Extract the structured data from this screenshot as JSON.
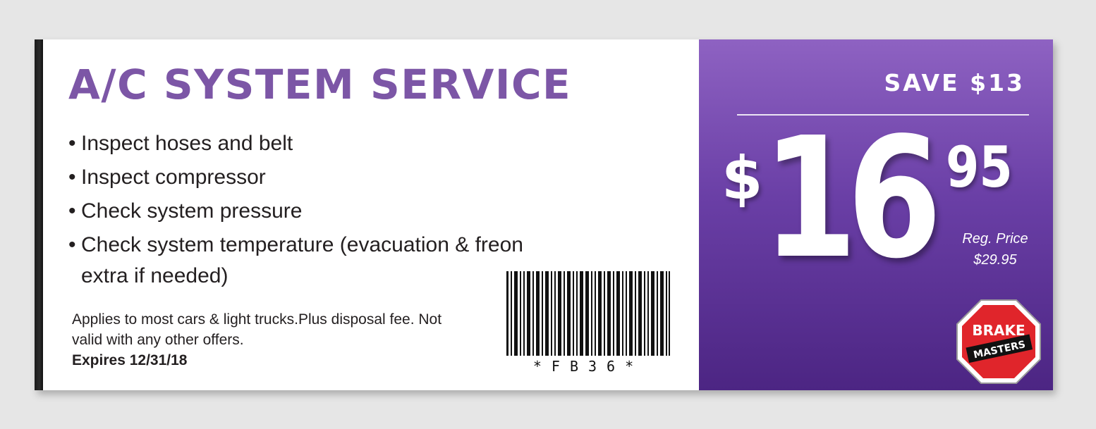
{
  "coupon": {
    "title": "A/C SYSTEM SERVICE",
    "bullets": [
      "Inspect hoses and belt",
      "Inspect compressor",
      "Check system pressure",
      "Check system temperature (evacuation & freon"
    ],
    "bullet_continuation": "extra if needed)",
    "bullet_marker": "•",
    "fine_print": "Applies to most cars & light trucks.Plus disposal fee. Not valid with any other offers.",
    "expires": "Expires 12/31/18",
    "barcode_text": "*FB36*"
  },
  "offer": {
    "save_label": "SAVE $13",
    "dollar_sign": "$",
    "price_dollars": "16",
    "price_cents": "95",
    "reg_price_label": "Reg. Price",
    "reg_price_value": "$29.95"
  },
  "logo": {
    "line1": "BRAKE",
    "line2": "MASTERS"
  },
  "colors": {
    "title_purple": "#7c56a6",
    "panel_purple_top": "#8e62c2",
    "panel_purple_bottom": "#4c2583",
    "logo_red": "#e0252b"
  },
  "icons": [
    "barcode-icon",
    "brake-masters-logo"
  ]
}
